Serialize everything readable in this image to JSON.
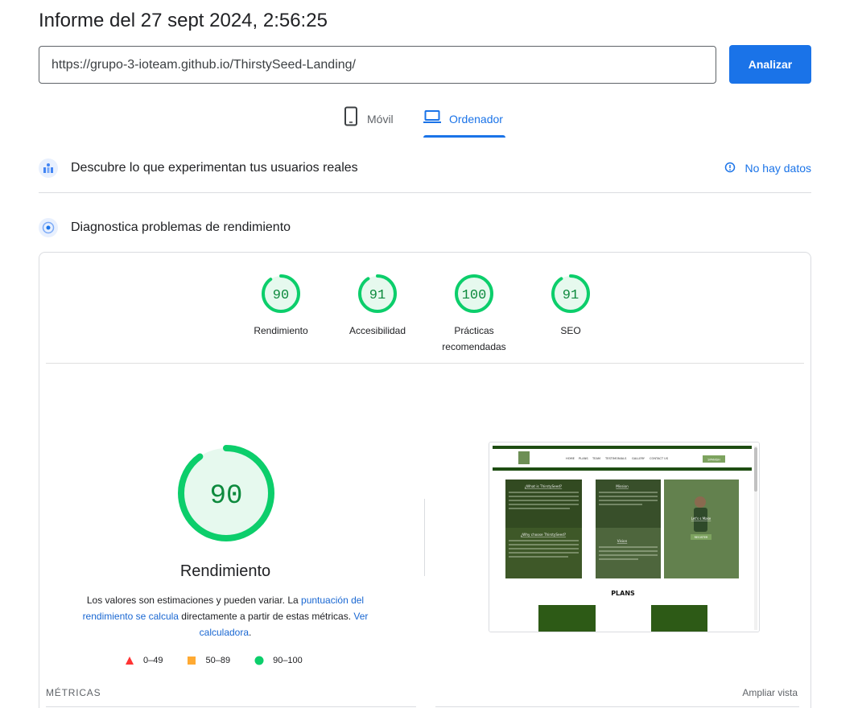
{
  "report": {
    "title": "Informe del 27 sept 2024, 2:56:25"
  },
  "search": {
    "url": "https://grupo-3-ioteam.github.io/ThirstySeed-Landing/",
    "analyze_label": "Analizar"
  },
  "tabs": [
    {
      "label": "Móvil",
      "icon": "phone-icon",
      "active": false
    },
    {
      "label": "Ordenador",
      "icon": "laptop-icon",
      "active": true
    }
  ],
  "field_data": {
    "label": "Descubre lo que experimentan tus usuarios reales",
    "status": "No hay datos"
  },
  "lab_data": {
    "label": "Diagnostica problemas de rendimiento"
  },
  "scores": [
    {
      "name": "Rendimiento",
      "value": "90",
      "fraction": 0.9
    },
    {
      "name": "Accesibilidad",
      "value": "91",
      "fraction": 0.91
    },
    {
      "name": "Prácticas recomendadas",
      "value": "100",
      "fraction": 1.0
    },
    {
      "name": "SEO",
      "value": "91",
      "fraction": 0.91
    }
  ],
  "performance": {
    "score": "90",
    "fraction": 0.9,
    "title": "Rendimiento",
    "desc_1": "Los valores son estimaciones y pueden variar. La ",
    "link_1": "puntuación del rendimiento se calcula",
    "desc_2": " directamente a partir de estas métricas. ",
    "link_2": "Ver calculadora",
    "desc_3": "."
  },
  "legend": [
    {
      "range": "0–49",
      "shape": "triangle",
      "color": "#ff3333"
    },
    {
      "range": "50–89",
      "shape": "square",
      "color": "#ffaa33"
    },
    {
      "range": "90–100",
      "shape": "circle",
      "color": "#0cce6b"
    }
  ],
  "metrics": {
    "label": "MÉTRICAS",
    "expand_label": "Ampliar vista"
  },
  "screenshot": {
    "nav": [
      "HOME",
      "PLANS",
      "TEAM",
      "TESTIMONIALS",
      "GALLERY",
      "CONTACT US"
    ],
    "lang_button": "SPANISH",
    "tiles": [
      "¿What is ThirstySeed?",
      "Mission",
      "¿Why choose ThirstySeed?",
      "Vision"
    ],
    "hero_title": "Let's s Make",
    "hero_button": "REGISTER",
    "section_title": "PLANS"
  },
  "colors": {
    "accent": "#1a73e8",
    "pass": "#0cce6b",
    "pass_text": "#0d8a3d",
    "pass_bg": "#e6f9ee"
  }
}
